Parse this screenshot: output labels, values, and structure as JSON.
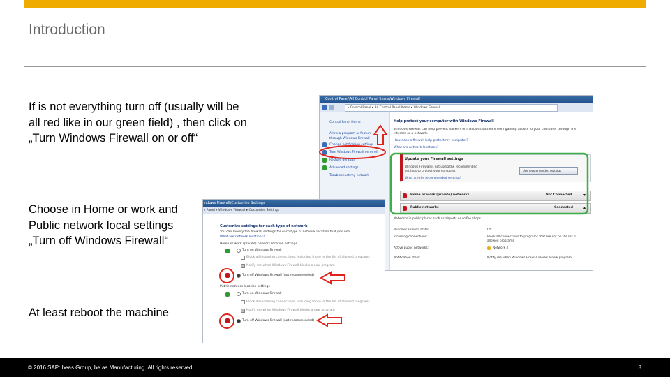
{
  "slide": {
    "title": "Introduction",
    "para1": "If is not everything turn off (usually will be all red like in our green field) , then click on „Turn Windows Firewall on or off“",
    "para2": "Choose in Home or work and Public network local settings „Turn off Windows Firewall“",
    "para3": "At least reboot the machine",
    "footer": "© 2016 SAP: beas Group, be.as Manufacturing. All rights reserved.",
    "page_number": "8",
    "accent_color": "#f0ab00"
  },
  "firewall_window": {
    "titlebar": "Control Panel\\All Control Panel Items\\Windows Firewall",
    "address": "▸ Control Panel ▸ All Control Panel Items ▸ Windows Firewall",
    "sidebar": [
      "Control Panel Home",
      "Allow a program or feature",
      "through Windows Firewall",
      "Change notification settings",
      "Turn Windows Firewall on or off",
      "Restore defaults",
      "Advanced settings",
      "Troubleshoot my network"
    ],
    "heading": "Help protect your computer with Windows Firewall",
    "desc1": "Windows Firewall can help prevent hackers or malicious software from gaining access to your computer through the",
    "desc2": "Internet or a network.",
    "link1": "How does a firewall help protect my computer?",
    "link2": "What are network locations?",
    "update_title": "Update your Firewall settings",
    "update_text1": "Windows Firewall is not using the recommended",
    "update_text2": "settings to protect your computer.",
    "update_link": "What are the recommended settings?",
    "recommended_button": "Use recommended settings",
    "network_home": "Home or work (private) networks",
    "network_home_status": "Not Connected",
    "network_public": "Public networks",
    "network_public_status": "Connected",
    "networks_note": "Networks in public places such as airports or coffee shops",
    "rows": [
      {
        "label": "Windows Firewall state:",
        "value": "Off"
      },
      {
        "label": "Incoming connections:",
        "value": "Block all connections to programs that are not on the list of"
      },
      {
        "label": "",
        "value": "allowed programs"
      },
      {
        "label": "Active public networks:",
        "value": "Network 3"
      },
      {
        "label": "Notification state:",
        "value": "Notify me when Windows Firewall blocks a new program"
      }
    ],
    "callout_color": "#e2231a",
    "highlight_color": "#3dae49"
  },
  "customize_window": {
    "titlebar": "ndows Firewall\\Customize Settings",
    "breadcrumb": "ı Panel ▸ Windows Firewall ▸ Customize Settings",
    "heading": "Customize settings for each type of network",
    "desc": "You can modify the firewall settings for each type of network location that you use.",
    "link": "What are network locations?",
    "home_section": "Home or work (private) network location settings",
    "public_section": "Public network location settings",
    "turn_on": "Turn on Windows Firewall",
    "block_all": "Block all incoming connections, including those in the list of allowed programs",
    "notify": "Notify me when Windows Firewall blocks a new program",
    "turn_off": "Turn off Windows Firewall (not recommended)"
  }
}
